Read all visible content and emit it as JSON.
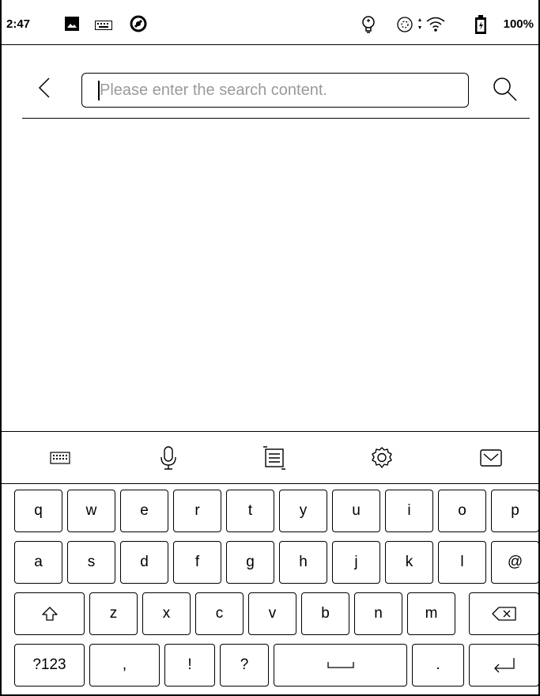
{
  "status_bar": {
    "time": "2:47",
    "battery": "100%",
    "icons": [
      "image-icon",
      "keyboard-icon",
      "app-icon",
      "frontlight-icon",
      "sync-icon",
      "wifi-icon",
      "battery-charging-icon"
    ]
  },
  "search": {
    "placeholder": "Please enter the search content.",
    "value": ""
  },
  "keyboard_toolbar": {
    "icons": [
      "keyboard-layout-icon",
      "microphone-icon",
      "clipboard-icon",
      "settings-icon",
      "hide-keyboard-icon"
    ]
  },
  "keyboard": {
    "row1": [
      "q",
      "w",
      "e",
      "r",
      "t",
      "y",
      "u",
      "i",
      "o",
      "p"
    ],
    "row2": [
      "a",
      "s",
      "d",
      "f",
      "g",
      "h",
      "j",
      "k",
      "l",
      "@"
    ],
    "row3": [
      "z",
      "x",
      "c",
      "v",
      "b",
      "n",
      "m"
    ],
    "row4": {
      "symbols": "?123",
      "comma": ",",
      "exclamation": "!",
      "question": "?",
      "period": "."
    }
  }
}
